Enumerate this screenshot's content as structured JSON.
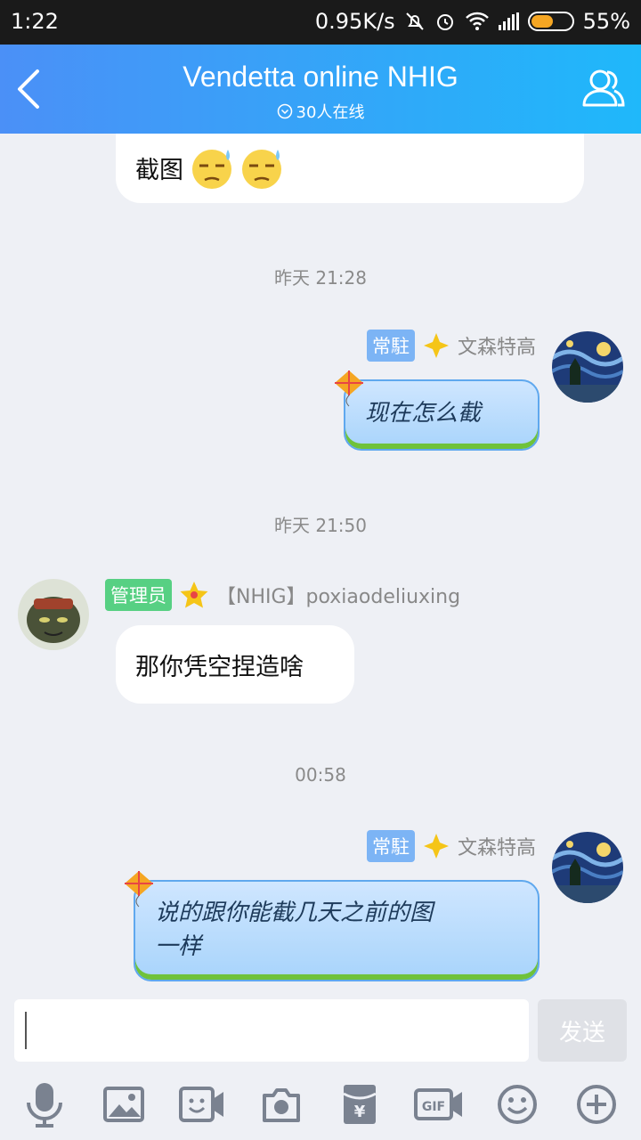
{
  "status_bar": {
    "time": "1:22",
    "speed": "0.95K/s",
    "battery": "55%"
  },
  "header": {
    "title": "Vendetta online NHIG",
    "online": "30人在线"
  },
  "messages": {
    "m1": {
      "text": "截图"
    },
    "t1": "昨天 21:28",
    "m2": {
      "tag": "常駐",
      "name": "文森特高",
      "text": "现在怎么截"
    },
    "t2": "昨天 21:50",
    "m3": {
      "tag": "管理员",
      "name": "【NHIG】poxiaodeliuxing",
      "text": "那你凭空捏造啥"
    },
    "t3": "00:58",
    "m4": {
      "tag": "常駐",
      "name": "文森特高",
      "text_line1": "说的跟你能截几天之前的图",
      "text_line2": "一样"
    }
  },
  "input": {
    "send_label": "发送"
  },
  "toolbar": [
    "mic-icon",
    "image-icon",
    "video-icon",
    "camera-icon",
    "red-packet-icon",
    "gif-icon",
    "emoji-icon",
    "plus-icon"
  ],
  "colors": {
    "header_start": "#4b90f7",
    "header_end": "#1fb8fa",
    "tag_blue": "#7cb4f5",
    "tag_green": "#57d083"
  }
}
